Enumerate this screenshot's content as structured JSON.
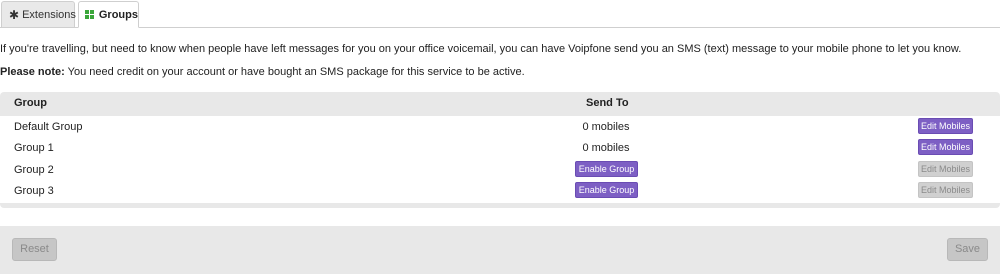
{
  "tabs": [
    {
      "label": "Extensions",
      "icon": "asterisk-icon",
      "active": false
    },
    {
      "label": "Groups",
      "icon": "grid-icon",
      "active": true
    }
  ],
  "intro_text": "If you're travelling, but need to know when people have left messages for you on your office voicemail, you can have Voipfone send you an SMS (text) message to your mobile phone to let you know.",
  "note": {
    "label": "Please note:",
    "text": " You need credit on your account or have bought an SMS package for this service to be active."
  },
  "table": {
    "headers": {
      "group": "Group",
      "send_to": "Send To"
    },
    "rows": [
      {
        "name": "Default Group",
        "send_to": "0 mobiles",
        "action": "Edit Mobiles",
        "enabled": true
      },
      {
        "name": "Group 1",
        "send_to": "0 mobiles",
        "action": "Edit Mobiles",
        "enabled": true
      },
      {
        "name": "Group 2",
        "send_to": "Enable Group",
        "action": "Edit Mobiles",
        "enabled": false
      },
      {
        "name": "Group 3",
        "send_to": "Enable Group",
        "action": "Edit Mobiles",
        "enabled": false
      }
    ]
  },
  "footer": {
    "reset_label": "Reset",
    "save_label": "Save"
  },
  "colors": {
    "accent": "#7d5fc4",
    "tab_icon_green": "#3aa63a",
    "disabled_gray": "#d0d0d0"
  }
}
